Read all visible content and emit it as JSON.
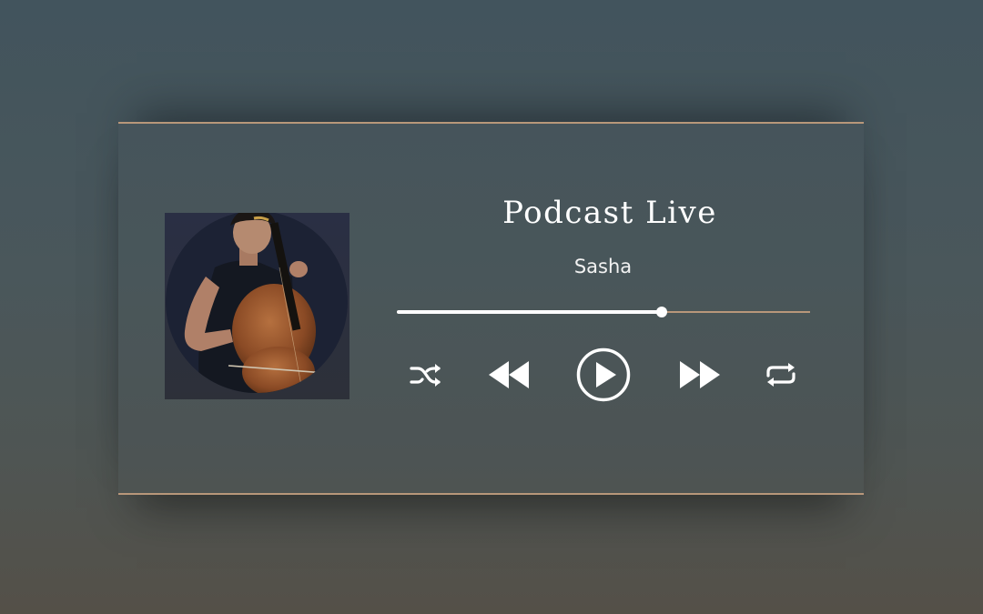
{
  "player": {
    "title": "Podcast Live",
    "artist": "Sasha",
    "progress_fraction": 0.64,
    "cover": {
      "description": "album-cover-cellist-photo"
    },
    "controls": {
      "shuffle_icon": "shuffle-icon",
      "rewind_icon": "rewind-icon",
      "play_icon": "play-circle-icon",
      "forward_icon": "fast-forward-icon",
      "repeat_icon": "repeat-icon"
    }
  },
  "colors": {
    "accent": "#b8977a",
    "text": "#ffffff",
    "background_top": "#42545d",
    "background_bottom": "#545048"
  }
}
